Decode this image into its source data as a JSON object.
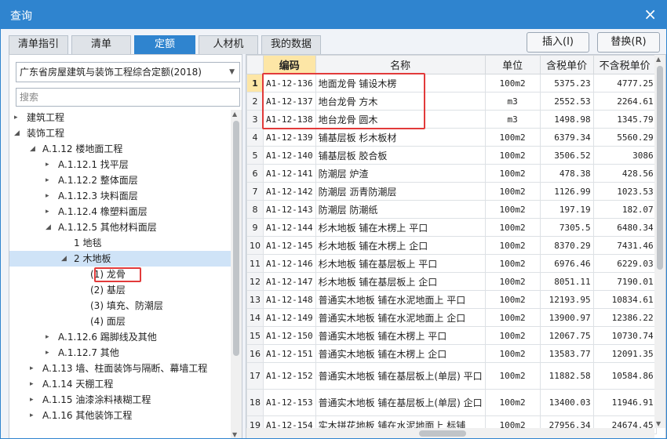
{
  "window": {
    "title": "查询",
    "close_icon": "×"
  },
  "tabs": [
    {
      "label": "清单指引",
      "active": false
    },
    {
      "label": "清单",
      "active": false
    },
    {
      "label": "定额",
      "active": true
    },
    {
      "label": "人材机",
      "active": false
    },
    {
      "label": "我的数据",
      "active": false
    }
  ],
  "actions": {
    "insert": "插入(I)",
    "replace": "替换(R)"
  },
  "left": {
    "library": "广东省房屋建筑与装饰工程综合定额(2018)",
    "search_placeholder": "搜索",
    "tree": [
      {
        "label": "建筑工程",
        "level": 0,
        "toggle": "▸"
      },
      {
        "label": "装饰工程",
        "level": 0,
        "toggle": "◢"
      },
      {
        "label": "A.1.12 楼地面工程",
        "level": 1,
        "toggle": "◢"
      },
      {
        "label": "A.1.12.1 找平层",
        "level": 2,
        "toggle": "▸"
      },
      {
        "label": "A.1.12.2 整体面层",
        "level": 2,
        "toggle": "▸"
      },
      {
        "label": "A.1.12.3 块料面层",
        "level": 2,
        "toggle": "▸"
      },
      {
        "label": "A.1.12.4 橡塑料面层",
        "level": 2,
        "toggle": "▸"
      },
      {
        "label": "A.1.12.5 其他材料面层",
        "level": 2,
        "toggle": "◢"
      },
      {
        "label": "1 地毯",
        "level": 3,
        "toggle": ""
      },
      {
        "label": "2 木地板",
        "level": 3,
        "toggle": "◢",
        "selected": true
      },
      {
        "label": "(1) 龙骨",
        "level": 4,
        "toggle": "",
        "highlighted": true
      },
      {
        "label": "(2) 基层",
        "level": 4,
        "toggle": ""
      },
      {
        "label": "(3) 填充、防潮层",
        "level": 4,
        "toggle": ""
      },
      {
        "label": "(4) 面层",
        "level": 4,
        "toggle": ""
      },
      {
        "label": "A.1.12.6 踢脚线及其他",
        "level": 2,
        "toggle": "▸"
      },
      {
        "label": "A.1.12.7 其他",
        "level": 2,
        "toggle": "▸"
      },
      {
        "label": "A.1.13 墙、柱面装饰与隔断、幕墙工程",
        "level": 1,
        "toggle": "▸"
      },
      {
        "label": "A.1.14 天棚工程",
        "level": 1,
        "toggle": "▸"
      },
      {
        "label": "A.1.15 油漆涂料裱糊工程",
        "level": 1,
        "toggle": "▸"
      },
      {
        "label": "A.1.16 其他装饰工程",
        "level": 1,
        "toggle": "▸"
      }
    ]
  },
  "grid": {
    "headers": {
      "rownum": "",
      "code": "编码",
      "name": "名称",
      "unit": "单位",
      "tax_price": "含税单价",
      "notax_price": "不含税单价"
    },
    "rows": [
      {
        "n": "1",
        "code": "A1-12-136",
        "name": "地面龙骨 铺设木楞",
        "unit": "100m2",
        "tax": "5375.23",
        "notax": "4777.25"
      },
      {
        "n": "2",
        "code": "A1-12-137",
        "name": "地台龙骨 方木",
        "unit": "m3",
        "tax": "2552.53",
        "notax": "2264.61"
      },
      {
        "n": "3",
        "code": "A1-12-138",
        "name": "地台龙骨 圆木",
        "unit": "m3",
        "tax": "1498.98",
        "notax": "1345.79"
      },
      {
        "n": "4",
        "code": "A1-12-139",
        "name": "铺基层板 杉木板材",
        "unit": "100m2",
        "tax": "6379.34",
        "notax": "5560.29"
      },
      {
        "n": "5",
        "code": "A1-12-140",
        "name": "铺基层板 胶合板",
        "unit": "100m2",
        "tax": "3506.52",
        "notax": "3086"
      },
      {
        "n": "6",
        "code": "A1-12-141",
        "name": "防潮层 炉渣",
        "unit": "100m2",
        "tax": "478.38",
        "notax": "428.56"
      },
      {
        "n": "7",
        "code": "A1-12-142",
        "name": "防潮层 沥青防潮层",
        "unit": "100m2",
        "tax": "1126.99",
        "notax": "1023.53"
      },
      {
        "n": "8",
        "code": "A1-12-143",
        "name": "防潮层 防潮纸",
        "unit": "100m2",
        "tax": "197.19",
        "notax": "182.07"
      },
      {
        "n": "9",
        "code": "A1-12-144",
        "name": "杉木地板 铺在木楞上 平口",
        "unit": "100m2",
        "tax": "7305.5",
        "notax": "6480.34"
      },
      {
        "n": "10",
        "code": "A1-12-145",
        "name": "杉木地板 铺在木楞上 企口",
        "unit": "100m2",
        "tax": "8370.29",
        "notax": "7431.46"
      },
      {
        "n": "11",
        "code": "A1-12-146",
        "name": "杉木地板 铺在基层板上 平口",
        "unit": "100m2",
        "tax": "6976.46",
        "notax": "6229.03"
      },
      {
        "n": "12",
        "code": "A1-12-147",
        "name": "杉木地板 铺在基层板上 企口",
        "unit": "100m2",
        "tax": "8051.11",
        "notax": "7190.01"
      },
      {
        "n": "13",
        "code": "A1-12-148",
        "name": "普通实木地板 铺在水泥地面上 平口",
        "unit": "100m2",
        "tax": "12193.95",
        "notax": "10834.61"
      },
      {
        "n": "14",
        "code": "A1-12-149",
        "name": "普通实木地板 铺在水泥地面上 企口",
        "unit": "100m2",
        "tax": "13900.97",
        "notax": "12386.22"
      },
      {
        "n": "15",
        "code": "A1-12-150",
        "name": "普通实木地板 铺在木楞上 平口",
        "unit": "100m2",
        "tax": "12067.75",
        "notax": "10730.74"
      },
      {
        "n": "16",
        "code": "A1-12-151",
        "name": "普通实木地板 铺在木楞上 企口",
        "unit": "100m2",
        "tax": "13583.77",
        "notax": "12091.35"
      },
      {
        "n": "17",
        "code": "A1-12-152",
        "name": "普通实木地板 铺在基层板上(单层) 平口",
        "unit": "100m2",
        "tax": "11882.58",
        "notax": "10584.86",
        "tall": true
      },
      {
        "n": "18",
        "code": "A1-12-153",
        "name": "普通实木地板 铺在基层板上(单层) 企口",
        "unit": "100m2",
        "tax": "13400.03",
        "notax": "11946.91",
        "tall": true
      },
      {
        "n": "19",
        "code": "A1-12-154",
        "name": "实木拼花地板 铺在水泥地面上 标铺",
        "unit": "100m2",
        "tax": "27956.34",
        "notax": "24674.45"
      }
    ]
  }
}
